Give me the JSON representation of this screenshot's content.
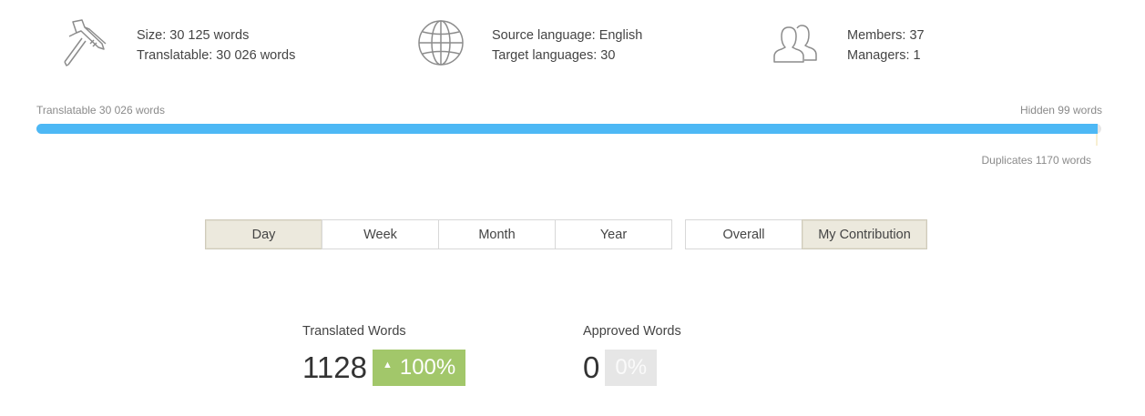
{
  "stats": {
    "size": {
      "line1": "Size: 30 125 words",
      "line2": "Translatable: 30 026 words",
      "icon": "caliper-icon"
    },
    "languages": {
      "line1": "Source language: English",
      "line2": "Target languages: 30",
      "icon": "globe-icon"
    },
    "members": {
      "line1": "Members: 37",
      "line2": "Managers: 1",
      "icon": "users-icon"
    }
  },
  "progress": {
    "translatable_label": "Translatable 30 026 words",
    "hidden_label": "Hidden 99 words",
    "duplicates_label": "Duplicates 1170 words",
    "total_words": 30125,
    "translatable_words": 30026,
    "hidden_words": 99,
    "duplicate_words": 1170,
    "fill_color": "#4db8f5",
    "duplicate_color": "#f8efd2"
  },
  "period_tabs": [
    {
      "label": "Day",
      "active": true
    },
    {
      "label": "Week",
      "active": false
    },
    {
      "label": "Month",
      "active": false
    },
    {
      "label": "Year",
      "active": false
    }
  ],
  "scope_tabs": [
    {
      "label": "Overall",
      "active": false
    },
    {
      "label": "My Contribution",
      "active": true
    }
  ],
  "metrics": {
    "translated": {
      "label": "Translated Words",
      "value": "1128",
      "badge": "100%",
      "trend": "up",
      "badge_color": "#a2c76a"
    },
    "approved": {
      "label": "Approved Words",
      "value": "0",
      "badge": "0%",
      "badge_color": "#e6e6e6"
    }
  }
}
